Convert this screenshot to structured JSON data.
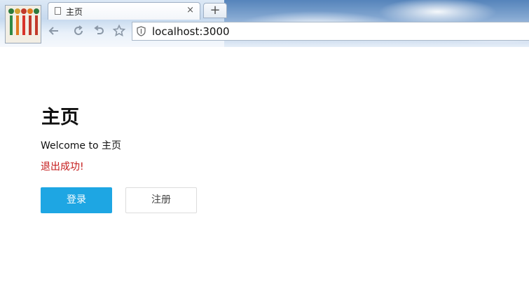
{
  "browser": {
    "tab_title": "主页",
    "tab_close": "×",
    "new_tab_label": "+",
    "address": "localhost:3000",
    "icons": [
      "back-icon",
      "reload-icon",
      "undo-icon",
      "bookmark-star-icon",
      "shield-icon",
      "page-icon"
    ]
  },
  "page": {
    "heading": "主页",
    "welcome_text": "Welcome to 主页",
    "notice_text": "退出成功!",
    "login_label": "登录",
    "register_label": "注册"
  },
  "colors": {
    "primary": "#1ea6e3",
    "notice": "#c41a1a"
  }
}
